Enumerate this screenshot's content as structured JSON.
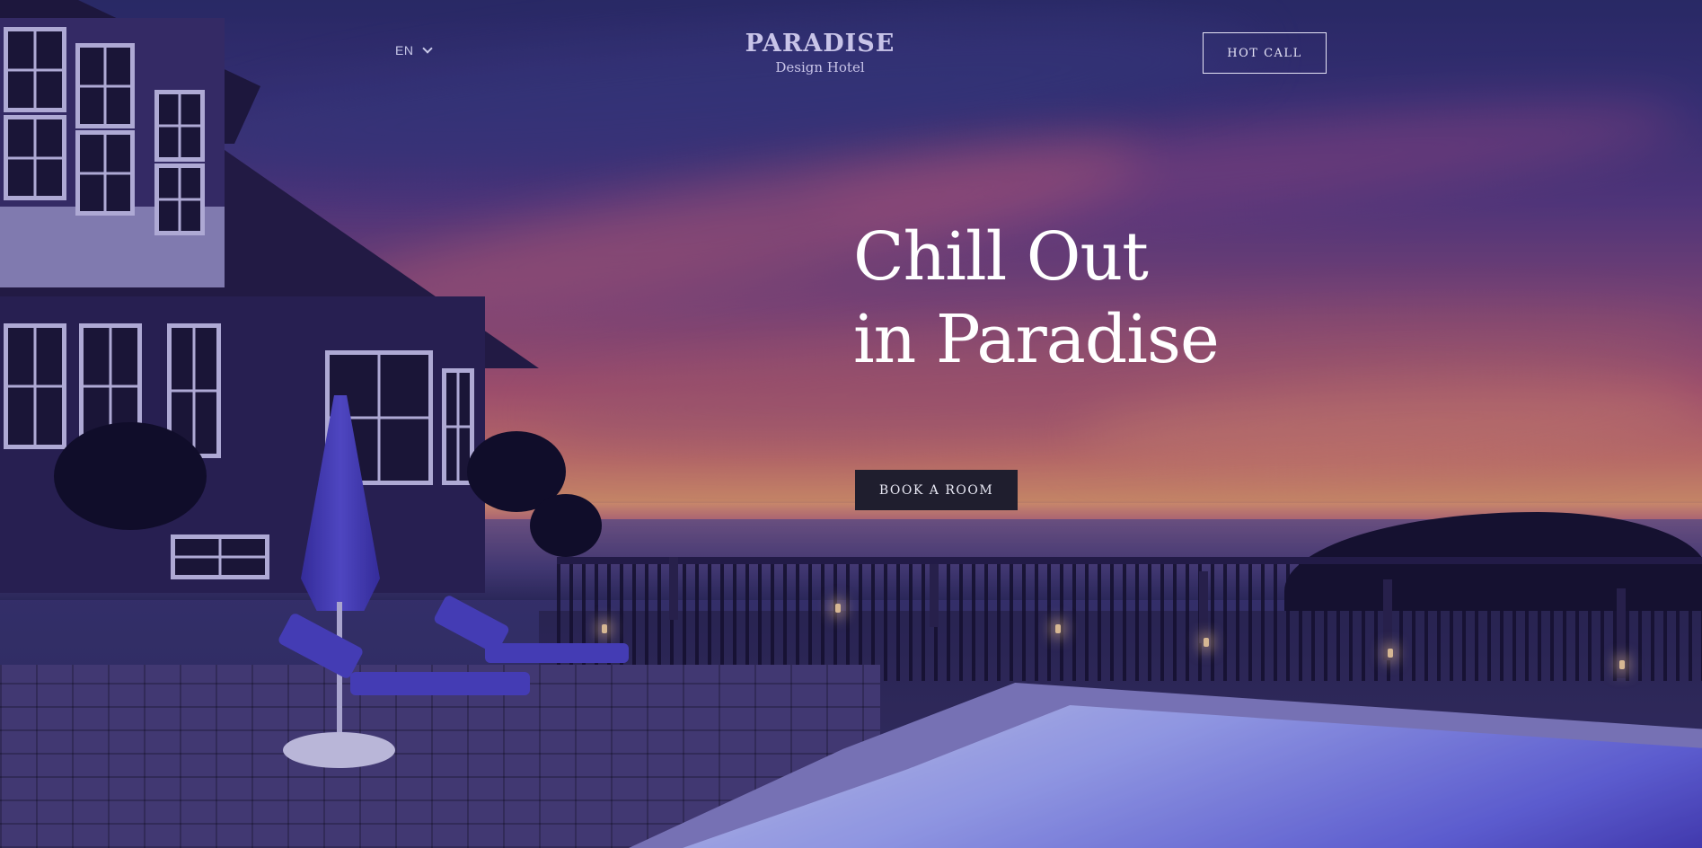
{
  "header": {
    "language": "EN",
    "brand_name": "PARADISE",
    "brand_subtitle": "Design Hotel",
    "hot_call_label": "HOT CALL"
  },
  "hero": {
    "headline_line1": "Chill Out",
    "headline_line2": "in Paradise",
    "cta_label": "BOOK A ROOM"
  },
  "icons": {
    "language_dropdown": "chevron-down-icon"
  },
  "colors": {
    "text_light": "#ffffff",
    "brand_text": "#c8c4e8",
    "cta_background": "#1f1e2e",
    "button_border": "#e6e4f6"
  }
}
